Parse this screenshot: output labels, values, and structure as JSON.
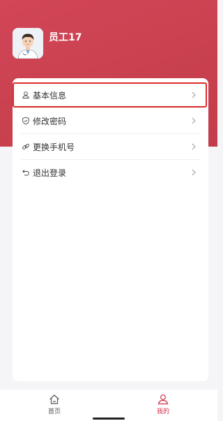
{
  "user": {
    "name": "员工17"
  },
  "menu": [
    {
      "label": "基本信息",
      "icon": "user-icon"
    },
    {
      "label": "修改密码",
      "icon": "shield-icon"
    },
    {
      "label": "更换手机号",
      "icon": "link-icon"
    },
    {
      "label": "退出登录",
      "icon": "logout-icon"
    }
  ],
  "tabbar": [
    {
      "label": "首页",
      "icon": "home-icon",
      "active": false
    },
    {
      "label": "我的",
      "icon": "profile-icon",
      "active": true
    }
  ],
  "colors": {
    "brand": "#c9414f",
    "active_tab": "#d2304a",
    "highlight": "#e02a2a"
  }
}
